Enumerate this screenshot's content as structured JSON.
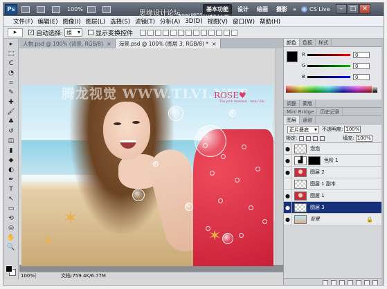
{
  "titlebar": {
    "logo": "Ps",
    "zoom": "100%",
    "watermark": "思缘设计论坛",
    "watermark_url": "www.MISSYUAN.COM",
    "workspaces": [
      "基本功能",
      "设计",
      "绘画",
      "摄影",
      "»"
    ],
    "cs_live": "CS Live",
    "window_controls": [
      "–",
      "□",
      "✕"
    ]
  },
  "menubar": {
    "items": [
      "文件(F)",
      "编辑(E)",
      "图像(I)",
      "图层(L)",
      "选择(S)",
      "滤镜(T)",
      "分析(A)",
      "3D(D)",
      "视图(V)",
      "窗口(W)",
      "帮助(H)"
    ]
  },
  "options": {
    "tool_icon": "▸",
    "auto_select_label": "自动选择:",
    "auto_select_checked": true,
    "auto_select_value": "组",
    "show_transform_label": "显示变换控件"
  },
  "toolbox": {
    "tools": [
      "move-tool",
      "marquee-tool",
      "lasso-tool",
      "quick-select-tool",
      "crop-tool",
      "eyedropper-tool",
      "healing-tool",
      "brush-tool",
      "stamp-tool",
      "history-brush-tool",
      "eraser-tool",
      "gradient-tool",
      "blur-tool",
      "dodge-tool",
      "pen-tool",
      "type-tool",
      "path-select-tool",
      "shape-tool",
      "3d-rotate-tool",
      "3d-orbit-tool",
      "hand-tool",
      "zoom-tool"
    ],
    "glyphs": [
      "▸",
      "⬚",
      "ᑕ",
      "◔",
      "⌗",
      "✎",
      "✚",
      "🖌",
      "♣",
      "↺",
      "◫",
      "▮",
      "◆",
      "◐",
      "✒",
      "T",
      "↖",
      "▭",
      "⟲",
      "◎",
      "✋",
      "🔍"
    ]
  },
  "document": {
    "tabs": [
      {
        "label": "人物.psd @ 100% (背景, RGB/8)",
        "close": "×",
        "active": false
      },
      {
        "label": "海景.psd @ 100% (图层 3, RGB/8) *",
        "close": "×",
        "active": true
      }
    ],
    "watermark_title": "腾龙视觉 WWW.TLVI.NET",
    "rose_text": "ROSE♥",
    "rose_sub": "The pink moment · rose / life",
    "status_zoom": "100%",
    "status_doc": "文档:759.4K/6.77M"
  },
  "panels": {
    "color_tabs": [
      "颜色",
      "色板",
      "样式"
    ],
    "channels": [
      {
        "label": "R",
        "value": "0",
        "color": "#d01818"
      },
      {
        "label": "G",
        "value": "0",
        "color": "#1a9a1a"
      },
      {
        "label": "B",
        "value": "0",
        "color": "#1a1ad0"
      }
    ],
    "adjust_tabs": [
      "调整",
      "蒙版"
    ],
    "mini_tabs": [
      "Mini Bridge",
      "历史记录"
    ],
    "layers_tabs": [
      "图层",
      "通道"
    ],
    "blend_mode": "正片叠底",
    "opacity_label": "不透明度:",
    "opacity_value": "100%",
    "lock_label": "锁定:",
    "fill_label": "填充:",
    "fill_value": "100%",
    "layers": [
      {
        "name": "泡泡",
        "visible": true,
        "thumb": "check",
        "selected": false
      },
      {
        "name": "色阶 1",
        "visible": true,
        "thumb": "adj",
        "selected": false
      },
      {
        "name": "图层 2",
        "visible": true,
        "thumb": "red",
        "selected": false
      },
      {
        "name": "图层 1 副本",
        "visible": false,
        "thumb": "check",
        "selected": false
      },
      {
        "name": "图层 1",
        "visible": true,
        "thumb": "red",
        "selected": false
      },
      {
        "name": "图层 3",
        "visible": true,
        "thumb": "check",
        "selected": true
      },
      {
        "name": "背景",
        "visible": true,
        "thumb": "photo",
        "selected": false
      }
    ]
  }
}
